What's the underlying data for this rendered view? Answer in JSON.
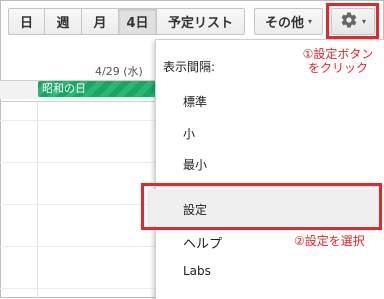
{
  "toolbar": {
    "day_label": "日",
    "week_label": "週",
    "month_label": "月",
    "fourday_label": "4日",
    "schedule_label": "予定リスト",
    "more_label": "その他",
    "more_caret": "▾",
    "gear_caret": "▾"
  },
  "calendar": {
    "date_header": "4/29 (水)",
    "holiday_event": "昭和の日",
    "holiday_color": "#16a765"
  },
  "menu": {
    "header": "表示間隔:",
    "items": [
      {
        "label": "標準"
      },
      {
        "label": "小"
      },
      {
        "label": "最小"
      },
      {
        "label": "設定"
      },
      {
        "label": "ヘルプ"
      },
      {
        "label": "Labs"
      }
    ]
  },
  "annotations": {
    "step1_line1": "①設定ボタン",
    "step1_line2": "をクリック",
    "step2": "②設定を選択",
    "highlight_color": "#e5262d"
  }
}
